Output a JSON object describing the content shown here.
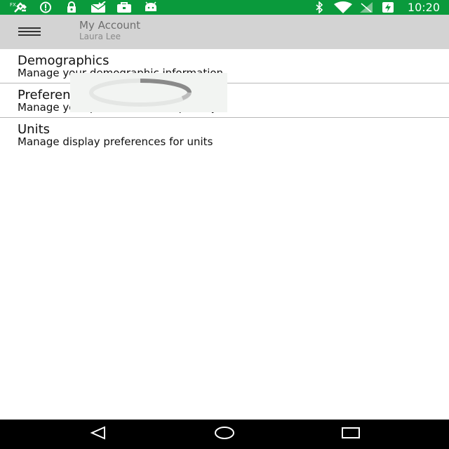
{
  "status_bar": {
    "time": "10:20",
    "left_icons": [
      "satellite-icon",
      "info-circle-icon",
      "lock-icon",
      "envelope-check-icon",
      "briefcase-icon",
      "android-icon"
    ],
    "right_icons": [
      "bluetooth-icon",
      "wifi-icon",
      "no-signal-icon",
      "battery-charging-icon"
    ],
    "bg_color": "#0a9a3c"
  },
  "app_bar": {
    "title": "My Account",
    "subtitle": "Laura Lee",
    "menu_icon": "hamburger-menu-icon",
    "bg_color": "#d3d3d3"
  },
  "list": {
    "items": [
      {
        "title": "Demographics",
        "description": "Manage your demographic information"
      },
      {
        "title": "Preferences",
        "description": "Manage your preferences and privacy"
      },
      {
        "title": "Units",
        "description": "Manage display preferences for units"
      }
    ]
  },
  "loading_indicator": {
    "icon": "loading-spinner-icon"
  },
  "nav_bar": {
    "buttons": [
      "back-icon",
      "home-icon",
      "recents-icon"
    ]
  }
}
